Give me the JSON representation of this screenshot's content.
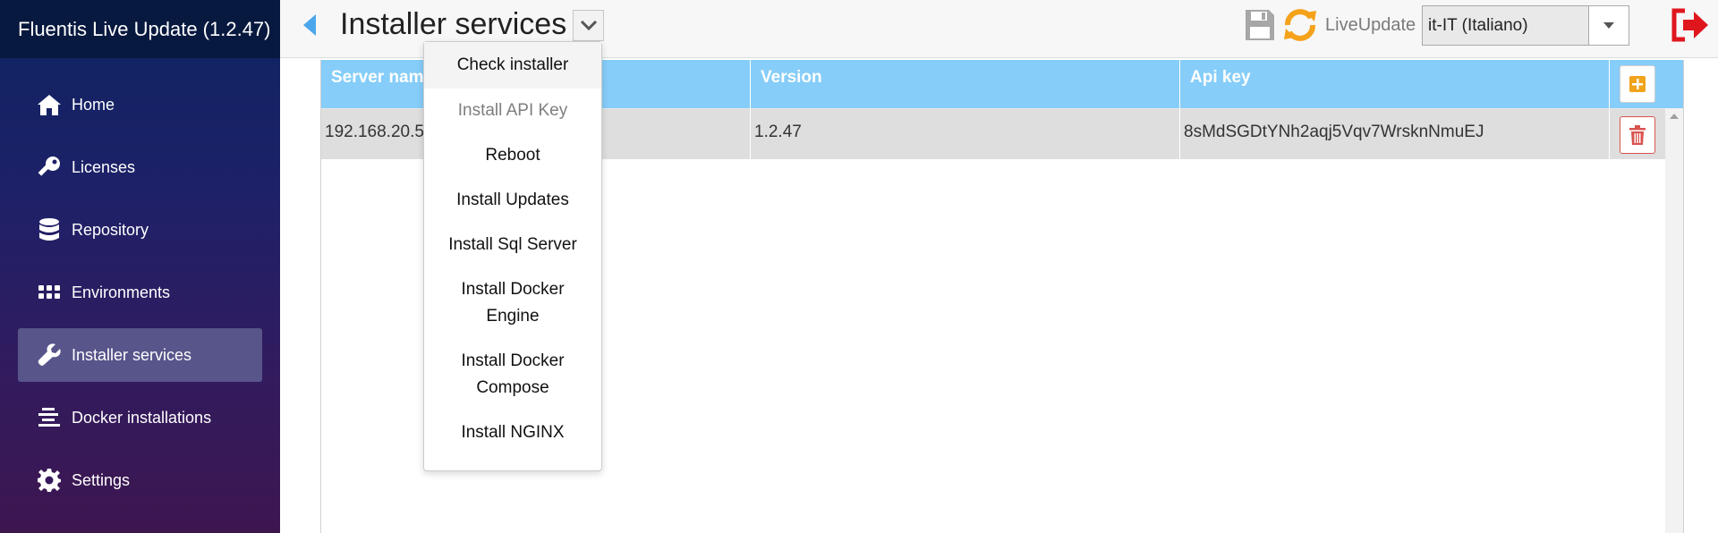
{
  "app": {
    "title": "Fluentis Live Update (1.2.47)"
  },
  "sidebar": {
    "items": [
      {
        "label": "Home",
        "icon": "home-icon"
      },
      {
        "label": "Licenses",
        "icon": "key-icon"
      },
      {
        "label": "Repository",
        "icon": "database-icon"
      },
      {
        "label": "Environments",
        "icon": "grid-icon"
      },
      {
        "label": "Installer services",
        "icon": "wrench-icon",
        "active": true
      },
      {
        "label": "Docker installations",
        "icon": "stack-icon"
      },
      {
        "label": "Settings",
        "icon": "gear-icon"
      }
    ]
  },
  "header": {
    "title": "Installer services",
    "liveupdate_label": "LiveUpdate",
    "language": {
      "selected": "it-IT (Italiano)"
    }
  },
  "table": {
    "columns": [
      "Server name",
      "Version",
      "Api key"
    ],
    "rows": [
      {
        "server": "192.168.20.5",
        "version": "1.2.47",
        "api_key": "8sMdSGDtYNh2aqj5Vqv7WrsknNmuEJ"
      }
    ]
  },
  "menu": {
    "items": [
      {
        "label": "Check installer",
        "state": "highlighted"
      },
      {
        "label": "Install API Key",
        "state": "disabled"
      },
      {
        "label": "Reboot",
        "state": "normal"
      },
      {
        "label": "Install Updates",
        "state": "normal"
      },
      {
        "label": "Install Sql Server",
        "state": "normal"
      },
      {
        "label": "Install Docker Engine",
        "state": "normal"
      },
      {
        "label": "Install Docker Compose",
        "state": "normal"
      },
      {
        "label": "Install NGINX",
        "state": "normal"
      }
    ]
  },
  "colors": {
    "accent": "#4ba6ec",
    "table_header": "#86cdf9",
    "sync_orange": "#f5a21b",
    "logout_red": "#e0161d",
    "delete_red": "#d9534f",
    "add_orange": "#f0a31b"
  }
}
